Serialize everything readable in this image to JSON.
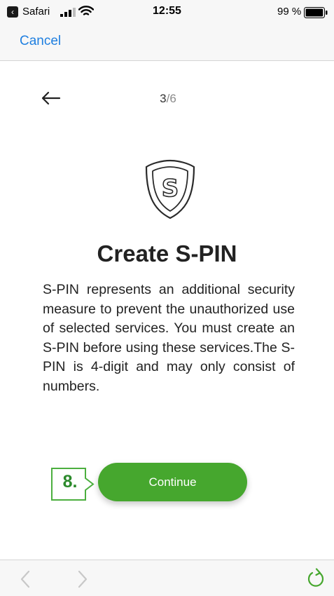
{
  "status_bar": {
    "back_app": "Safari",
    "time": "12:55",
    "battery_percent": "99 %",
    "battery_level": 0.99
  },
  "nav": {
    "cancel_label": "Cancel"
  },
  "content": {
    "step_current": "3",
    "step_separator": "/",
    "step_total": "6",
    "title": "Create S-PIN",
    "description": "S-PIN represents an additional security measure to prevent the unauthorized use of selected services. You must create an S-PIN before using these services.The S-PIN is 4-digit and may only consist of numbers.",
    "shield_letter": "S",
    "continue_label": "Continue",
    "callout_label": "8."
  },
  "icons": {
    "back": "arrow-left-icon",
    "shield": "shield-s-icon",
    "toolbar_back": "chevron-left-icon",
    "toolbar_forward": "chevron-right-icon",
    "reload": "reload-icon"
  },
  "colors": {
    "accent_green": "#46a72e",
    "link_blue": "#1f7fe0",
    "callout_green": "#2c8a2c"
  }
}
